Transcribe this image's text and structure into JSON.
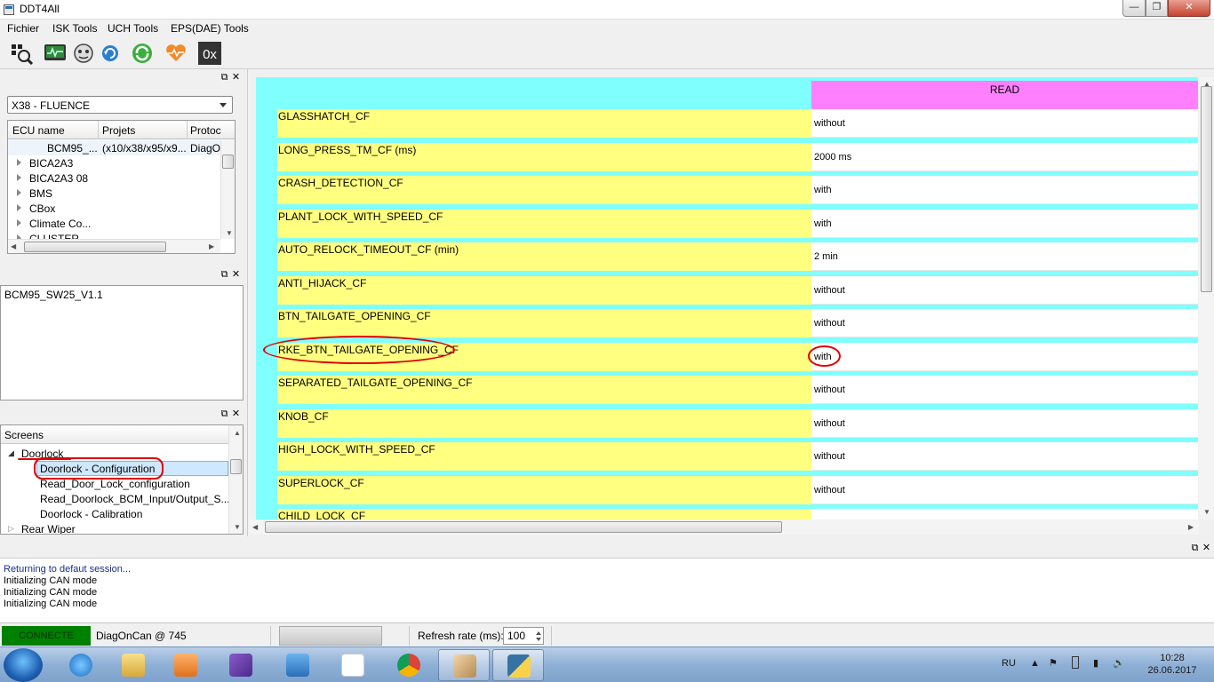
{
  "window": {
    "title": "DDT4All",
    "min": "—",
    "max": "❐",
    "close": "✕"
  },
  "menu": [
    "Fichier",
    "ISK Tools",
    "UCH Tools",
    "EPS(DAE) Tools"
  ],
  "toolbar": {
    "hex_label": "0x"
  },
  "dock": {
    "float": "⧉",
    "close": "✕"
  },
  "vehicle_select": {
    "value": "X38 - FLUENCE"
  },
  "ecu_table": {
    "headers": [
      "ECU name",
      "Projets",
      "Protoc"
    ],
    "selected": {
      "name": "BCM95_...",
      "projets": "(x10/x38/x95/x9...",
      "protocol": "DiagO"
    },
    "items": [
      "BICA2A3",
      "BICA2A3 08",
      "BMS",
      "CBox",
      "Climate Co...",
      "CLUSTER"
    ]
  },
  "ecu_files": {
    "items": [
      "BCM95_SW25_V1.1"
    ]
  },
  "screens": {
    "header": "Screens",
    "group": "Doorlock",
    "children": [
      "Doorlock - Configuration",
      "Read_Door_Lock_configuration",
      "Read_Doorlock_BCM_Input/Output_S...",
      "Doorlock - Calibration"
    ],
    "next_group": "Rear Wiper"
  },
  "main": {
    "read_header": "READ",
    "params": [
      {
        "label": "GLASSHATCH_CF",
        "value": "without"
      },
      {
        "label": "LONG_PRESS_TM_CF (ms)",
        "value": "2000 ms"
      },
      {
        "label": "CRASH_DETECTION_CF",
        "value": "with"
      },
      {
        "label": "PLANT_LOCK_WITH_SPEED_CF",
        "value": "with"
      },
      {
        "label": "AUTO_RELOCK_TIMEOUT_CF (min)",
        "value": "2 min"
      },
      {
        "label": "ANTI_HIJACK_CF",
        "value": "without"
      },
      {
        "label": "BTN_TAILGATE_OPENING_CF",
        "value": "without"
      },
      {
        "label": "RKE_BTN_TAILGATE_OPENING_CF",
        "value": "with"
      },
      {
        "label": "SEPARATED_TAILGATE_OPENING_CF",
        "value": "without"
      },
      {
        "label": "KNOB_CF",
        "value": "without"
      },
      {
        "label": "HIGH_LOCK_WITH_SPEED_CF",
        "value": "without"
      },
      {
        "label": "SUPERLOCK_CF",
        "value": "without"
      },
      {
        "label": "CHILD_LOCK_CF",
        "value": ""
      }
    ]
  },
  "log": [
    "Returning to defaut session...",
    "Initializing CAN mode",
    "Initializing CAN mode",
    "Initializing CAN mode"
  ],
  "status": {
    "connection": "CONNECTE",
    "adapter": "DiagOnCan @ 745",
    "refresh_label": "Refresh rate (ms):",
    "refresh_value": "100"
  },
  "taskbar": {
    "lang": "RU",
    "time": "10:28",
    "date": "26.06.2017"
  },
  "colors": {
    "canvas_bg": "#80ffff",
    "label_bg": "#ffff80",
    "header_bg": "#ff80ff",
    "connect_bg": "#008000",
    "annotation": "#e00000"
  }
}
